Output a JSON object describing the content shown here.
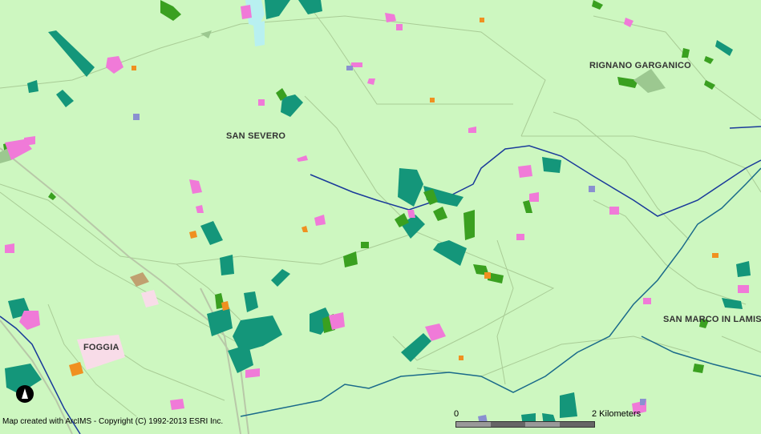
{
  "places": {
    "san_severo": "SAN SEVERO",
    "rignano": "RIGNANO GARGANICO",
    "san_marco": "SAN MARCO IN LAMIS",
    "foggia": "FOGGIA"
  },
  "credit": "Map created with ArcIMS - Copyright (C) 1992-2013 ESRI Inc.",
  "scale": {
    "start": "0",
    "end": "2 Kilometers"
  },
  "colors": {
    "background": "#cdf7c0",
    "teal_parcel": "#14967a",
    "green_parcel": "#3aa020",
    "pink_parcel": "#f07ad8",
    "orange_parcel": "#f09020",
    "boundary": "#b8d8a8",
    "river": "#1a3a9a"
  },
  "icons": {
    "north": "north-arrow-icon"
  }
}
